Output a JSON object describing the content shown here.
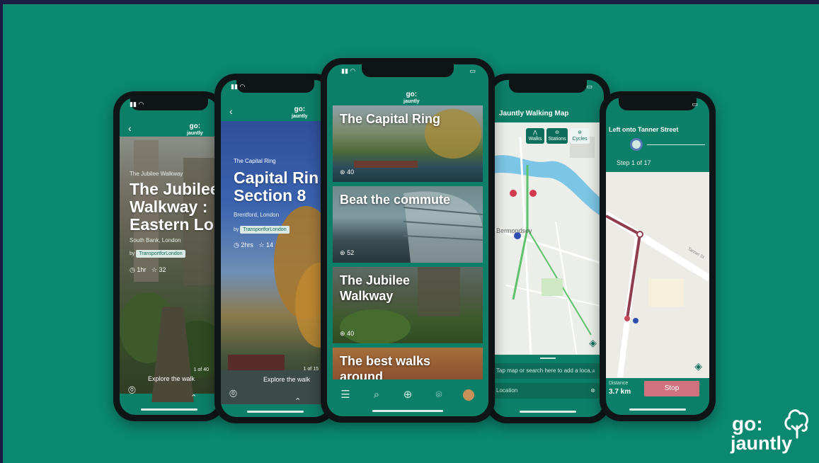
{
  "brand": {
    "logo_top": "go:",
    "logo_bottom": "jauntly"
  },
  "colors": {
    "background": "#0b8870",
    "frame": "#1b1d45",
    "accent": "#0c7f68",
    "stop": "#d0727e"
  },
  "phone1": {
    "subtitle": "The Jubilee Walkway",
    "title_l1": "The Jubilee",
    "title_l2": "Walkway :",
    "title_l3": "Eastern Lo",
    "location": "South Bank, London",
    "by": "by",
    "organisation": "TransportforLondon",
    "duration": "1hr",
    "rating": "32",
    "pager": "1 of 40",
    "explore": "Explore the walk"
  },
  "phone2": {
    "subtitle": "The Capital Ring",
    "title_l1": "Capital Rin",
    "title_l2": "Section 8",
    "location": "Brentford, London",
    "by": "by",
    "organisation": "TransportforLondon",
    "duration": "2hrs",
    "rating": "14",
    "pager": "1 of 15",
    "explore": "Explore the walk"
  },
  "phone3": {
    "cards": [
      {
        "title": "The Capital Ring",
        "count": "40"
      },
      {
        "title": "Beat the commute",
        "count": "52"
      },
      {
        "title": "The Jubilee Walkway",
        "count": "40"
      },
      {
        "title": "The best walks around",
        "count": ""
      }
    ],
    "nav": [
      "list-icon",
      "search-icon",
      "add-icon",
      "location-icon",
      "profile-icon"
    ]
  },
  "phone4": {
    "header": "Jauntly Walking Map",
    "filters": [
      "Walks",
      "Stations",
      "Cycles"
    ],
    "area_label": "Bermondsey",
    "search_placeholder": "Tap map or search here to add a loca...",
    "location_field": "Location"
  },
  "phone5": {
    "instruction": "Left onto Tanner Street",
    "step": "Step 1 of 17",
    "distance_label": "Distance",
    "distance_value": "3.7 km",
    "stop_label": "Stop",
    "street_label": "Tanner St"
  }
}
